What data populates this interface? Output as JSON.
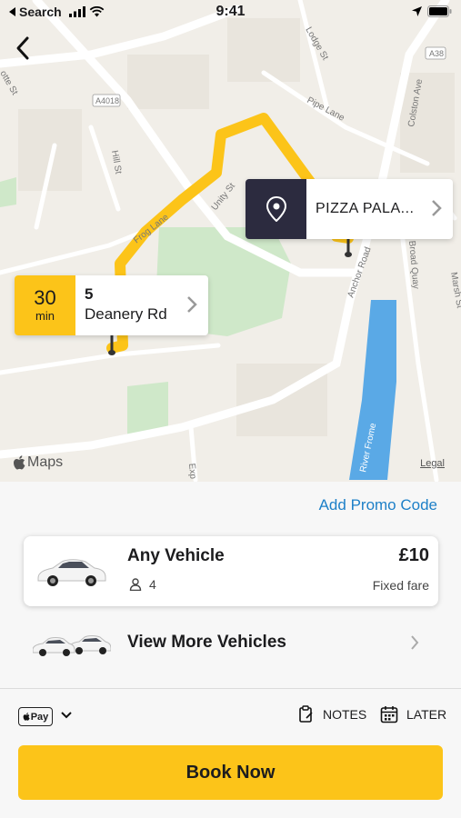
{
  "status_bar": {
    "back_app": "Search",
    "time": "9:41"
  },
  "map": {
    "street_labels": [
      "Frog Lane",
      "Unity St",
      "Hill St",
      "Lodge St",
      "Pipe Lane",
      "Colston Ave",
      "Anchor Road",
      "Broad Quay",
      "Marsh St",
      "River Frome",
      "A4018",
      "A38",
      "Exp",
      "otte St"
    ],
    "route_color": "#fcc419",
    "origin": {
      "eta_number": "30",
      "eta_unit": "min",
      "house_number": "5",
      "street": "Deanery Rd"
    },
    "destination": {
      "name": "PIZZA PALA..."
    },
    "attribution": "Maps",
    "legal": "Legal"
  },
  "booking": {
    "promo_label": "Add Promo Code",
    "vehicle": {
      "name": "Any Vehicle",
      "seats": "4",
      "price": "£10",
      "fare_type": "Fixed fare"
    },
    "more_vehicles_label": "View More Vehicles",
    "payment": {
      "method": "Pay"
    },
    "notes_label": "NOTES",
    "later_label": "LATER",
    "book_label": "Book Now"
  },
  "colors": {
    "accent": "#fcc419",
    "link": "#1e80c8",
    "dark": "#2c2b3f"
  }
}
